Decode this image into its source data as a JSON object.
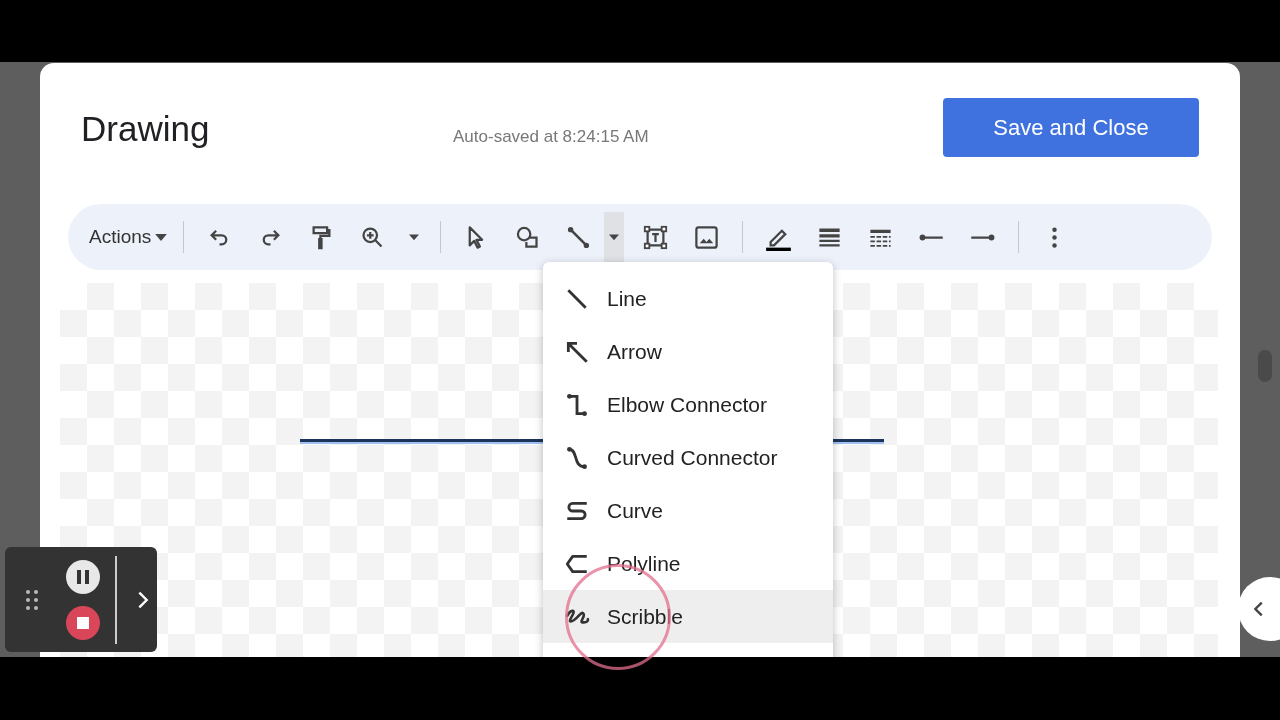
{
  "dialog": {
    "title": "Drawing",
    "autosave": "Auto-saved at 8:24:15 AM",
    "save_button": "Save and Close"
  },
  "toolbar": {
    "actions_label": "Actions",
    "line_menu_open": true
  },
  "line_menu": [
    {
      "kind": "line",
      "label": "Line",
      "selected": false
    },
    {
      "kind": "arrow",
      "label": "Arrow",
      "selected": false
    },
    {
      "kind": "elbow",
      "label": "Elbow Connector",
      "selected": false
    },
    {
      "kind": "curved",
      "label": "Curved Connector",
      "selected": false
    },
    {
      "kind": "curve",
      "label": "Curve",
      "selected": false
    },
    {
      "kind": "polyline",
      "label": "Polyline",
      "selected": false
    },
    {
      "kind": "scribble",
      "label": "Scribble",
      "selected": true
    }
  ]
}
